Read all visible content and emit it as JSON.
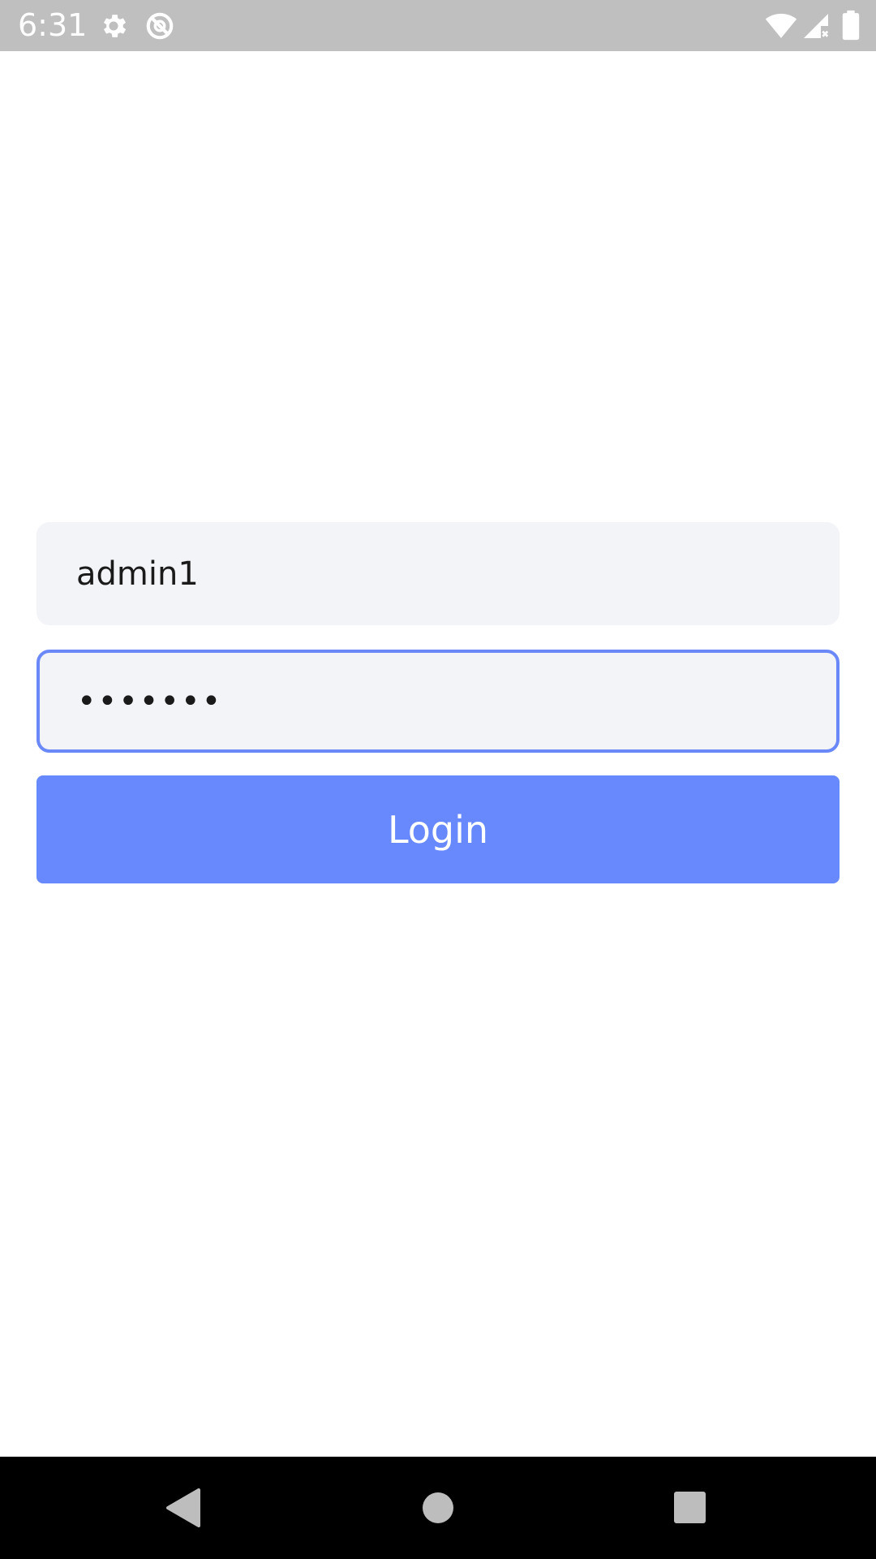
{
  "status_bar": {
    "time": "6:31",
    "left_icons": [
      "gear-icon",
      "no-sync-icon"
    ],
    "right_icons": [
      "wifi-icon",
      "cell-signal-no-data-icon",
      "battery-icon"
    ]
  },
  "login_form": {
    "username_value": "admin1",
    "password_value": "•••••••",
    "login_label": "Login"
  },
  "nav_bar": {
    "icons": [
      "back-icon",
      "home-icon",
      "recents-icon"
    ]
  },
  "colors": {
    "status_bar_bg": "#bfbfbf",
    "field_bg": "#f3f4f8",
    "focus_border": "#6a88f7",
    "primary_button": "#6889fe",
    "nav_bar_bg": "#000000"
  }
}
